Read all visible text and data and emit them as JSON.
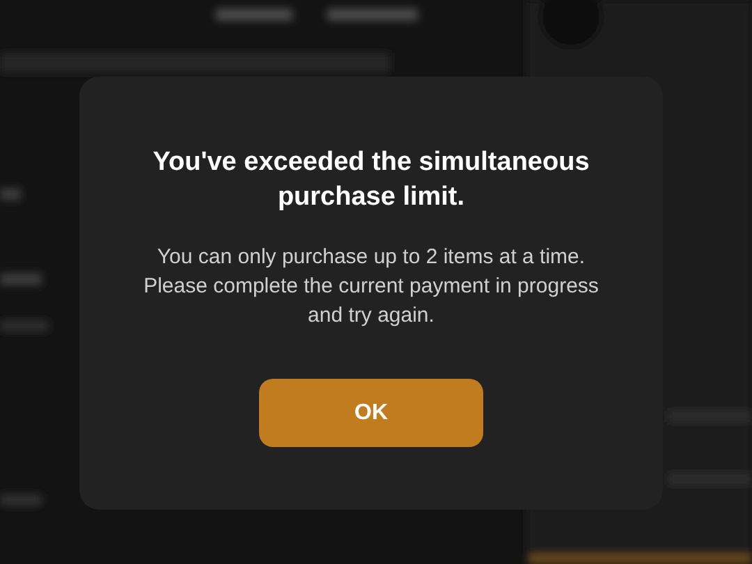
{
  "dialog": {
    "title": "You've exceeded the simultaneous purchase limit.",
    "message": "You can only purchase up to 2 items at a time. Please complete the current payment in progress and try again.",
    "buttons": [
      "OK"
    ]
  }
}
